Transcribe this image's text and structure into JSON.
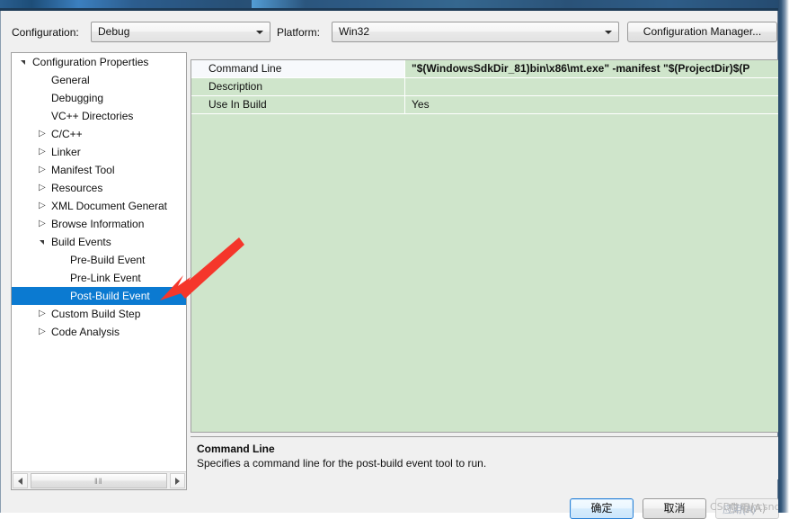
{
  "window": {
    "title_bar_visible": true
  },
  "toolbar": {
    "configuration_label": "Configuration:",
    "configuration_value": "Debug",
    "platform_label": "Platform:",
    "platform_value": "Win32",
    "configuration_manager_label": "Configuration Manager..."
  },
  "tree": {
    "items": [
      {
        "label": "Configuration Properties",
        "indent": 0,
        "twisty": "expanded",
        "selected": false
      },
      {
        "label": "General",
        "indent": 1,
        "twisty": "none",
        "selected": false
      },
      {
        "label": "Debugging",
        "indent": 1,
        "twisty": "none",
        "selected": false
      },
      {
        "label": "VC++ Directories",
        "indent": 1,
        "twisty": "none",
        "selected": false
      },
      {
        "label": "C/C++",
        "indent": 1,
        "twisty": "collapsed",
        "selected": false
      },
      {
        "label": "Linker",
        "indent": 1,
        "twisty": "collapsed",
        "selected": false
      },
      {
        "label": "Manifest Tool",
        "indent": 1,
        "twisty": "collapsed",
        "selected": false
      },
      {
        "label": "Resources",
        "indent": 1,
        "twisty": "collapsed",
        "selected": false
      },
      {
        "label": "XML Document Generat",
        "indent": 1,
        "twisty": "collapsed",
        "selected": false
      },
      {
        "label": "Browse Information",
        "indent": 1,
        "twisty": "collapsed",
        "selected": false
      },
      {
        "label": "Build Events",
        "indent": 1,
        "twisty": "expanded",
        "selected": false
      },
      {
        "label": "Pre-Build Event",
        "indent": 2,
        "twisty": "none",
        "selected": false
      },
      {
        "label": "Pre-Link Event",
        "indent": 2,
        "twisty": "none",
        "selected": false
      },
      {
        "label": "Post-Build Event",
        "indent": 2,
        "twisty": "none",
        "selected": true
      },
      {
        "label": "Custom Build Step",
        "indent": 1,
        "twisty": "collapsed",
        "selected": false
      },
      {
        "label": "Code Analysis",
        "indent": 1,
        "twisty": "collapsed",
        "selected": false
      }
    ],
    "hscroll_grip": "‖‖"
  },
  "grid": {
    "rows": [
      {
        "name": "Command Line",
        "value": "\"$(WindowsSdkDir_81)bin\\x86\\mt.exe\" -manifest \"$(ProjectDir)$(P",
        "active": true
      },
      {
        "name": "Description",
        "value": "",
        "active": false
      },
      {
        "name": "Use In Build",
        "value": "Yes",
        "active": false
      }
    ]
  },
  "description": {
    "title": "Command Line",
    "text": "Specifies a command line for the post-build event tool to run."
  },
  "buttons": {
    "ok": "确定",
    "cancel": "取消",
    "apply": "应用(A)"
  },
  "watermark": {
    "text": "CSDN @hcsnql",
    "overlay": "应用(A)"
  },
  "annotation": {
    "arrow_color": "#f5362b",
    "points_to": "Post-Build Event"
  },
  "colors": {
    "selection_blue": "#0b7ad1",
    "grid_green": "#cfe5cb",
    "dialog_gray": "#f0f0f0",
    "accent_ok_border": "#2c84d8"
  }
}
